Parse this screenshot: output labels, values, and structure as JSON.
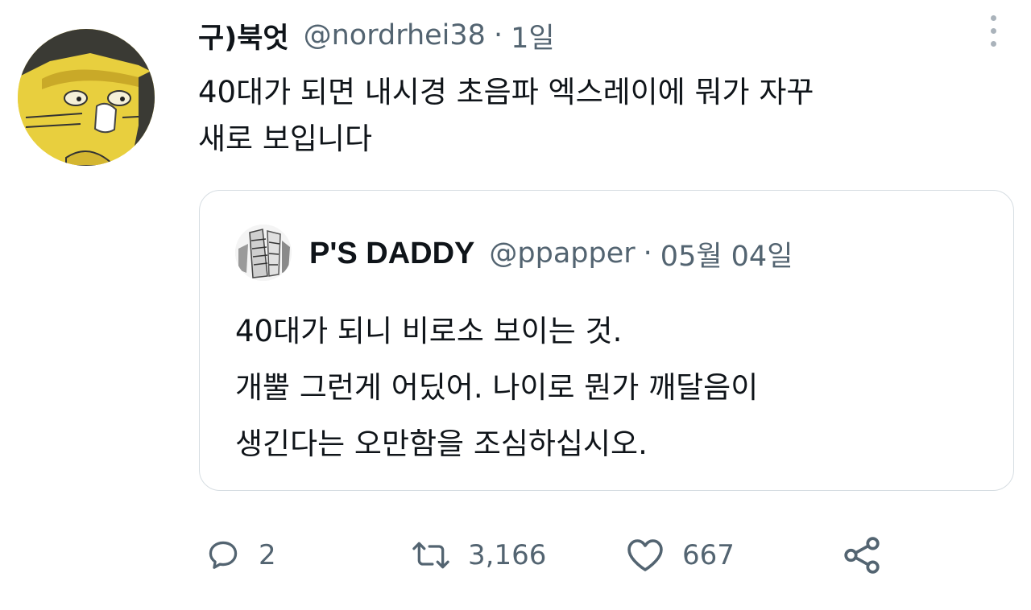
{
  "tweet": {
    "display_name": "구)북엇",
    "handle": "@nordrhei38",
    "separator": "·",
    "time": "1일",
    "text_lines": [
      "40대가 되면 내시경 초음파 엑스레이에 뭐가 자꾸",
      "새로 보입니다"
    ]
  },
  "quoted_tweet": {
    "display_name": "P'S DADDY",
    "handle": "@ppapper",
    "separator": "·",
    "time": "05월 04일",
    "text_lines": [
      "40대가 되니 비로소 보이는 것.",
      "개뿔 그런게 어딨어. 나이로 뭔가 깨달음이",
      "생긴다는 오만함을 조심하십시오."
    ]
  },
  "actions": {
    "reply": {
      "icon": "reply-icon",
      "count": "2"
    },
    "retweet": {
      "icon": "retweet-icon",
      "count": "3,166"
    },
    "like": {
      "icon": "heart-icon",
      "count": "667"
    },
    "share": {
      "icon": "share-icon"
    }
  },
  "colors": {
    "primary_text": "#0f1419",
    "secondary_text": "#536471",
    "border": "#d6dde2",
    "avatar_bg": "#e8cf3e"
  }
}
